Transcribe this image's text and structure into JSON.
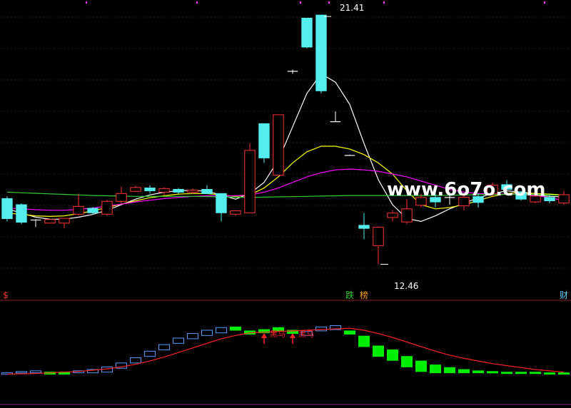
{
  "chart_data": [
    {
      "type": "candlestick",
      "title": "",
      "price_range": [
        11.5,
        21.9
      ],
      "high_label": "21.41",
      "low_label": "12.46",
      "candles": [
        {
          "o": 14.82,
          "c": 14.1,
          "h": 14.9,
          "l": 14.0
        },
        {
          "o": 14.6,
          "c": 13.97,
          "h": 14.65,
          "l": 13.9
        },
        {
          "o": 14.05,
          "c": 14.05,
          "h": 14.08,
          "l": 13.8
        },
        {
          "o": 13.94,
          "c": 14.07,
          "h": 14.1,
          "l": 13.92
        },
        {
          "o": 13.94,
          "c": 14.11,
          "h": 14.11,
          "l": 13.75
        },
        {
          "o": 14.26,
          "c": 14.54,
          "h": 15.0,
          "l": 14.2
        },
        {
          "o": 14.47,
          "c": 14.31,
          "h": 14.52,
          "l": 14.25
        },
        {
          "o": 14.26,
          "c": 14.72,
          "h": 14.78,
          "l": 14.2
        },
        {
          "o": 14.72,
          "c": 15.0,
          "h": 15.25,
          "l": 14.65
        },
        {
          "o": 15.08,
          "c": 15.22,
          "h": 15.28,
          "l": 15.05
        },
        {
          "o": 15.2,
          "c": 15.1,
          "h": 15.3,
          "l": 15.0
        },
        {
          "o": 15.05,
          "c": 15.18,
          "h": 15.22,
          "l": 14.95
        },
        {
          "o": 15.15,
          "c": 15.05,
          "h": 15.2,
          "l": 14.98
        },
        {
          "o": 15.05,
          "c": 15.12,
          "h": 15.18,
          "l": 14.98
        },
        {
          "o": 15.15,
          "c": 15.0,
          "h": 15.3,
          "l": 14.98
        },
        {
          "o": 15.0,
          "c": 14.31,
          "h": 15.0,
          "l": 14.0
        },
        {
          "o": 14.26,
          "c": 14.38,
          "h": 14.4,
          "l": 14.2
        },
        {
          "o": 14.31,
          "c": 16.55,
          "h": 16.8,
          "l": 14.31
        },
        {
          "o": 17.51,
          "c": 16.28,
          "h": 17.51,
          "l": 16.1
        },
        {
          "o": 15.66,
          "c": 17.83,
          "h": 17.83,
          "l": 15.66
        },
        {
          "o": 19.39,
          "c": 19.38,
          "h": 19.45,
          "l": 19.3
        },
        {
          "o": 21.3,
          "c": 20.26,
          "h": 21.3,
          "l": 20.22
        },
        {
          "o": 21.41,
          "c": 18.69,
          "h": 21.41,
          "l": 18.6
        },
        {
          "o": 17.58,
          "c": 17.58,
          "h": 17.95,
          "l": 17.58
        },
        {
          "o": 16.37,
          "c": 16.37,
          "h": 16.4,
          "l": 16.37
        },
        {
          "o": 13.86,
          "c": 13.75,
          "h": 14.3,
          "l": 13.36
        },
        {
          "o": 13.13,
          "c": 13.79,
          "h": 13.82,
          "l": 12.46
        },
        {
          "o": 14.14,
          "c": 14.3,
          "h": 14.4,
          "l": 14.0
        },
        {
          "o": 13.98,
          "c": 14.45,
          "h": 14.8,
          "l": 13.9
        },
        {
          "o": 14.58,
          "c": 14.86,
          "h": 15.0,
          "l": 14.5
        },
        {
          "o": 14.86,
          "c": 14.7,
          "h": 15.1,
          "l": 14.5
        },
        {
          "o": 14.86,
          "c": 14.86,
          "h": 15.05,
          "l": 14.6
        },
        {
          "o": 14.56,
          "c": 14.87,
          "h": 15.0,
          "l": 14.4
        },
        {
          "o": 14.89,
          "c": 14.68,
          "h": 15.02,
          "l": 14.5
        },
        {
          "o": 14.99,
          "c": 15.3,
          "h": 15.4,
          "l": 14.9
        },
        {
          "o": 15.32,
          "c": 15.15,
          "h": 15.48,
          "l": 15.1
        },
        {
          "o": 15.05,
          "c": 14.8,
          "h": 15.1,
          "l": 14.75
        },
        {
          "o": 14.7,
          "c": 14.91,
          "h": 14.95,
          "l": 14.65
        },
        {
          "o": 14.86,
          "c": 14.74,
          "h": 14.95,
          "l": 14.65
        },
        {
          "o": 14.66,
          "c": 14.96,
          "h": 15.1,
          "l": 14.6
        }
      ],
      "moving_averages": [
        {
          "color": "#ffffff",
          "values": [
            14.45,
            14.3,
            14.15,
            14.08,
            14.08,
            14.15,
            14.25,
            14.4,
            14.6,
            14.8,
            14.95,
            15.05,
            15.1,
            15.12,
            15.08,
            14.95,
            14.8,
            15.0,
            15.4,
            16.2,
            17.4,
            18.6,
            19.3,
            19.0,
            18.2,
            16.8,
            15.5,
            14.6,
            14.1,
            14.0,
            14.2,
            14.45,
            14.65,
            14.85,
            15.0,
            15.1,
            15.05,
            14.95,
            14.9,
            14.88
          ]
        },
        {
          "color": "#ffff00",
          "values": [
            14.3,
            14.25,
            14.2,
            14.18,
            14.2,
            14.28,
            14.38,
            14.5,
            14.62,
            14.74,
            14.85,
            14.92,
            14.98,
            15.0,
            15.0,
            14.95,
            14.9,
            14.95,
            15.2,
            15.6,
            16.1,
            16.5,
            16.7,
            16.7,
            16.6,
            16.4,
            16.1,
            15.7,
            15.1,
            14.6,
            14.45,
            14.5,
            14.6,
            14.75,
            14.9,
            15.0,
            15.05,
            15.0,
            14.98,
            14.95
          ]
        },
        {
          "color": "#ff00ff",
          "values": [
            14.48,
            14.45,
            14.42,
            14.4,
            14.4,
            14.43,
            14.48,
            14.55,
            14.62,
            14.7,
            14.76,
            14.82,
            14.86,
            14.9,
            14.92,
            14.92,
            14.92,
            14.95,
            15.05,
            15.2,
            15.4,
            15.6,
            15.75,
            15.85,
            15.88,
            15.85,
            15.8,
            15.7,
            15.6,
            15.45,
            15.3,
            15.15,
            15.05,
            15.0,
            14.98,
            14.98,
            14.97,
            14.93,
            14.85,
            14.75
          ]
        },
        {
          "color": "#33cc33",
          "values": [
            15.05,
            15.03,
            15.01,
            14.99,
            14.97,
            14.95,
            14.93,
            14.92,
            14.91,
            14.9,
            14.9,
            14.9,
            14.9,
            14.9,
            14.89,
            14.88,
            14.87,
            14.86,
            14.87,
            14.88,
            14.89,
            14.9,
            14.91,
            14.92,
            14.93,
            14.93,
            14.93,
            14.93,
            14.93,
            14.93,
            14.93,
            14.94,
            14.95,
            14.96,
            14.97,
            14.97,
            14.97,
            14.96,
            14.95,
            14.94
          ]
        }
      ],
      "markers": [
        {
          "candle": 0,
          "text": "$",
          "color": "#ff3333"
        },
        {
          "candle": 24,
          "text": "跌",
          "color": "#33cc33"
        },
        {
          "candle": 25,
          "text": "榜",
          "color": "#ff9900"
        },
        {
          "candle": 39,
          "text": "财",
          "color": "#66ccff"
        }
      ]
    },
    {
      "type": "bar",
      "title": "",
      "value_range": [
        -8,
        90
      ],
      "bars": [
        {
          "v": 0,
          "c": "#5599ff"
        },
        {
          "v": 2,
          "c": "#5599ff"
        },
        {
          "v": 3,
          "c": "#5599ff"
        },
        {
          "v": -1,
          "c": "#00ee00"
        },
        {
          "v": -2,
          "c": "#00ee00"
        },
        {
          "v": 3,
          "c": "#5599ff"
        },
        {
          "v": 5,
          "c": "#5599ff"
        },
        {
          "v": 9,
          "c": "#5599ff"
        },
        {
          "v": 15,
          "c": "#5599ff"
        },
        {
          "v": 23,
          "c": "#5599ff"
        },
        {
          "v": 33,
          "c": "#5599ff"
        },
        {
          "v": 43,
          "c": "#5599ff"
        },
        {
          "v": 53,
          "c": "#5599ff"
        },
        {
          "v": 60,
          "c": "#5599ff"
        },
        {
          "v": 65,
          "c": "#5599ff"
        },
        {
          "v": 69,
          "c": "#5599ff"
        },
        {
          "v": 70,
          "c": "#00ee00"
        },
        {
          "v": 64,
          "c": "#00ee00"
        },
        {
          "v": 66,
          "c": "#00ee00"
        },
        {
          "v": 69,
          "c": "#00ee00"
        },
        {
          "v": 65,
          "c": "#00ee00"
        },
        {
          "v": 63,
          "c": "#5599ff"
        },
        {
          "v": 70,
          "c": "#5599ff"
        },
        {
          "v": 72,
          "c": "#5599ff"
        },
        {
          "v": 64,
          "c": "#00ee00"
        },
        {
          "v": 56,
          "c": "#00ee00"
        },
        {
          "v": 41,
          "c": "#00ee00"
        },
        {
          "v": 35,
          "c": "#00ee00"
        },
        {
          "v": 25,
          "c": "#00ee00"
        },
        {
          "v": 18,
          "c": "#00ee00"
        },
        {
          "v": 12,
          "c": "#00ee00"
        },
        {
          "v": 8,
          "c": "#00ee00"
        },
        {
          "v": 5,
          "c": "#00ee00"
        },
        {
          "v": 3,
          "c": "#00ee00"
        },
        {
          "v": 2,
          "c": "#00ee00"
        },
        {
          "v": 1,
          "c": "#00ee00"
        },
        {
          "v": 1,
          "c": "#00ee00"
        },
        {
          "v": 1,
          "c": "#00ee00"
        },
        {
          "v": 0,
          "c": "#00ee00"
        },
        {
          "v": 0,
          "c": "#00ee00"
        }
      ],
      "line": {
        "color": "#ff2222",
        "values": [
          -2,
          -1.5,
          -1,
          0,
          1,
          2,
          4,
          6,
          9,
          13,
          18,
          24,
          31,
          38,
          45,
          52,
          57,
          61,
          62,
          63,
          64,
          65,
          66,
          67,
          68,
          65,
          60,
          54,
          47,
          40,
          33,
          27,
          22,
          18,
          14,
          11,
          8,
          5,
          3,
          1
        ]
      },
      "signals": [
        {
          "candle": 18,
          "text": "黑马",
          "color": "#ff2222"
        },
        {
          "candle": 20,
          "text": "黑马",
          "color": "#ff2222"
        }
      ]
    }
  ],
  "watermark": "www.6o7o.com"
}
